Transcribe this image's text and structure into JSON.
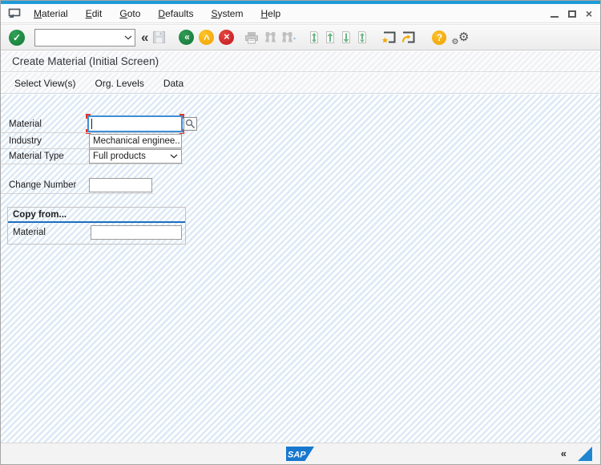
{
  "menu_bar": {
    "items": [
      "Material",
      "Edit",
      "Goto",
      "Defaults",
      "System",
      "Help"
    ]
  },
  "toolbar": {
    "command_field": {
      "value": ""
    }
  },
  "header": {
    "title": "Create Material (Initial Screen)"
  },
  "app_toolbar": {
    "buttons": [
      "Select View(s)",
      "Org. Levels",
      "Data"
    ]
  },
  "form": {
    "material": {
      "label": "Material",
      "value": "",
      "required": true
    },
    "industry": {
      "label": "Industry",
      "value": "Mechanical enginee.."
    },
    "material_type": {
      "label": "Material Type",
      "value": "Full products"
    },
    "change_number": {
      "label": "Change Number",
      "value": ""
    },
    "copy_from": {
      "title": "Copy from...",
      "material": {
        "label": "Material",
        "value": ""
      }
    }
  },
  "status_bar": {
    "logo_text": "SAP"
  },
  "icons": {
    "enter_glyph": "✓",
    "back_glyph": "«",
    "exit_glyph": "^",
    "cancel_glyph": "×",
    "help_glyph": "?",
    "collapse_command_glyph": "«",
    "status_collapse_glyph": "«",
    "window_close_glyph": "×",
    "gear_glyph": "⚙"
  },
  "colors": {
    "top_accent": "#1e9bd7",
    "stripe_blue": "#dde9f5",
    "focus_border": "#3f8fd5",
    "required_marker": "#e0352b",
    "group_rule_blue": "#1a6fc0",
    "sap_logo_blue": "#1778cf",
    "enter_green": "#127a36",
    "exit_orange": "#eda202",
    "cancel_red": "#c2191d"
  }
}
